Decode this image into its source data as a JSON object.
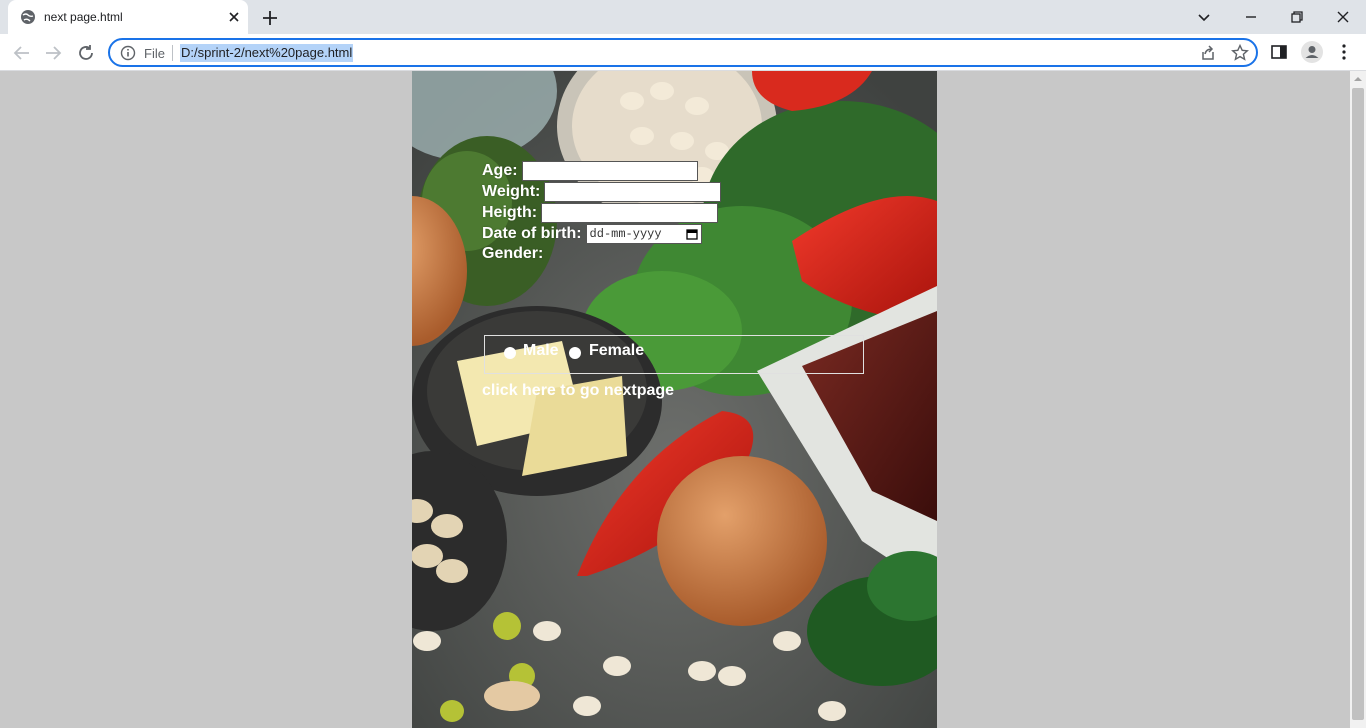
{
  "browser": {
    "tab_title": "next page.html",
    "scheme_label": "File",
    "url": "D:/sprint-2/next%20page.html"
  },
  "form": {
    "age_label": "Age:",
    "weight_label": "Weight:",
    "height_label": "Heigth:",
    "dob_label": "Date of birth:",
    "dob_placeholder": "dd-mm-yyyy",
    "gender_label": "Gender:",
    "male_label": "Male",
    "female_label": "Female",
    "next_link": "click here to go nextpage"
  },
  "colors": {
    "accent": "#1a73e8",
    "selection": "#b4d3f8",
    "page_background": "#c8c8c8"
  }
}
